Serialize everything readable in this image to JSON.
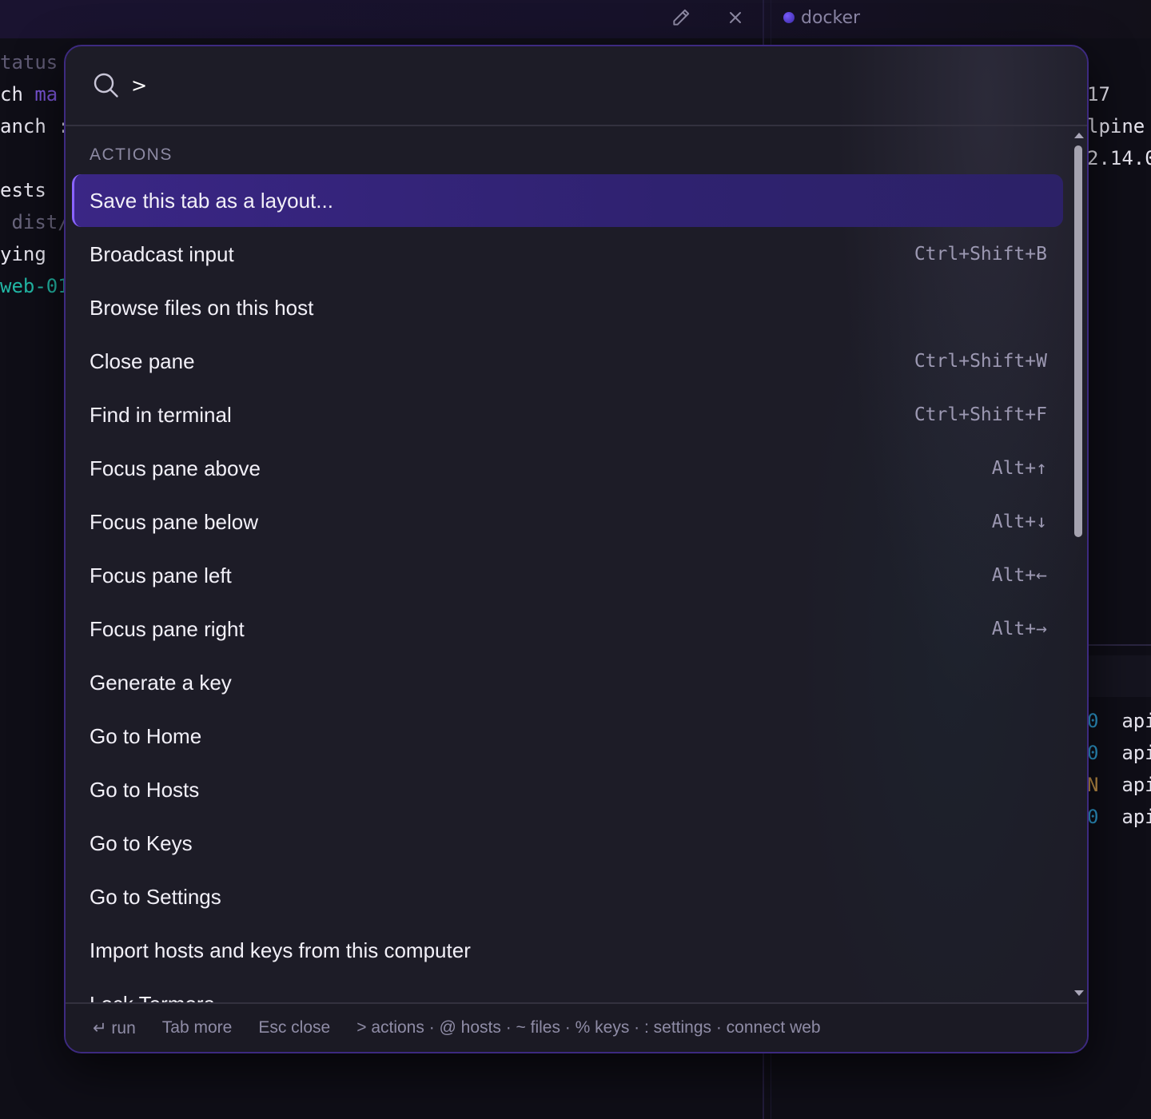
{
  "background": {
    "docker_tab_label": "docker",
    "left_terminal_lines": [
      {
        "text": "tatus",
        "color": "#5f5a74"
      },
      {
        "text": "ch ",
        "color": "#e8e6f0",
        "extra": "ma",
        "extra_color": "#7b55d9"
      },
      {
        "text": "anch :",
        "color": "#e8e6f0"
      },
      {
        "text": "",
        "color": "#e8e6f0"
      },
      {
        "text": "ests ",
        "color": "#e8e6f0"
      },
      {
        "text": " dist/",
        "color": "#6a667e"
      },
      {
        "text": "ying ",
        "color": "#e8e6f0"
      },
      {
        "text": "web-01",
        "color": "#22b8a6"
      }
    ],
    "right_terminal_top": [
      "17",
      "lpine",
      "2.14.0"
    ],
    "right_terminal_bottom": [
      {
        "a": "0",
        "a_color": "#2f9fd6",
        "b": "api"
      },
      {
        "a": "0",
        "a_color": "#2f9fd6",
        "b": "api"
      },
      {
        "a": "N",
        "a_color": "#c9974a",
        "b": "api"
      },
      {
        "a": "0",
        "a_color": "#2f9fd6",
        "b": "api"
      }
    ]
  },
  "palette": {
    "query": ">",
    "section": "ACTIONS",
    "items": [
      {
        "label": "Save this tab as a layout...",
        "shortcut": "",
        "selected": true
      },
      {
        "label": "Broadcast input",
        "shortcut": "Ctrl+Shift+B"
      },
      {
        "label": "Browse files on this host",
        "shortcut": ""
      },
      {
        "label": "Close pane",
        "shortcut": "Ctrl+Shift+W"
      },
      {
        "label": "Find in terminal",
        "shortcut": "Ctrl+Shift+F"
      },
      {
        "label": "Focus pane above",
        "shortcut": "Alt+↑"
      },
      {
        "label": "Focus pane below",
        "shortcut": "Alt+↓"
      },
      {
        "label": "Focus pane left",
        "shortcut": "Alt+←"
      },
      {
        "label": "Focus pane right",
        "shortcut": "Alt+→"
      },
      {
        "label": "Generate a key",
        "shortcut": ""
      },
      {
        "label": "Go to Home",
        "shortcut": ""
      },
      {
        "label": "Go to Hosts",
        "shortcut": ""
      },
      {
        "label": "Go to Keys",
        "shortcut": ""
      },
      {
        "label": "Go to Settings",
        "shortcut": ""
      },
      {
        "label": "Import hosts and keys from this computer",
        "shortcut": ""
      },
      {
        "label": "Lock Termora",
        "shortcut": ""
      }
    ],
    "footer": {
      "run": "↵ run",
      "more": "Tab more",
      "close": "Esc close",
      "prefixes": "> actions · @ hosts · ~ files · % keys · : settings · connect web"
    }
  },
  "colors": {
    "accent": "#8a63ff",
    "selected_bg": "#33237a",
    "palette_bg": "#1d1c27"
  }
}
